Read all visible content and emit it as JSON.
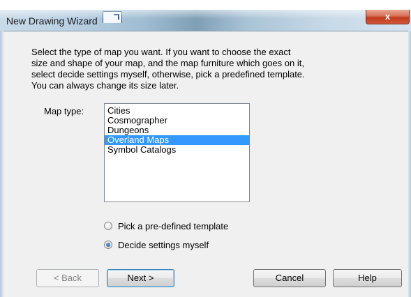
{
  "window": {
    "title": "New Drawing Wizard",
    "close_glyph": "x"
  },
  "instructions": [
    "Select the type of map you want. If you want to choose the exact",
    "size and shape of your map, and the map furniture which goes on it,",
    "select decide settings myself, otherwise, pick a predefined template.",
    "You can always change its size later."
  ],
  "map_type": {
    "label": "Map type:",
    "items": [
      "Cities",
      "Cosmographer",
      "Dungeons",
      "Overland Maps",
      "Symbol Catalogs"
    ],
    "selected_index": 3
  },
  "options": [
    {
      "label": "Pick a pre-defined template",
      "checked": false
    },
    {
      "label": "Decide settings myself",
      "checked": true
    }
  ],
  "buttons": {
    "back": "< Back",
    "next": "Next >",
    "cancel": "Cancel",
    "help": "Help"
  },
  "colors": {
    "selection": "#3399ff",
    "close_button": "#c4391c"
  },
  "icons": {
    "title_icon": "drawing-document-icon",
    "close_icon": "close-icon"
  }
}
